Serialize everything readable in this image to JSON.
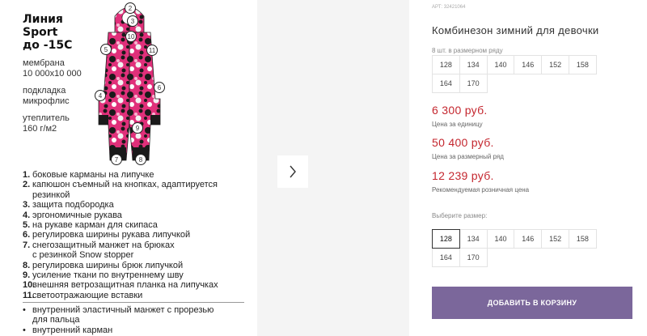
{
  "left_panel": {
    "line_title": [
      "Линия",
      "Sport",
      "до -15С"
    ],
    "specs": [
      "мембрана",
      "10 000х10 000",
      "подкладка",
      "микрофлис",
      "утеплитель",
      "160 г/м2"
    ],
    "numbered_features": [
      {
        "n": "1.",
        "text": "боковые карманы на липучке"
      },
      {
        "n": "2.",
        "text": "капюшон съемный на кнопках, адаптируется"
      },
      {
        "n": "",
        "text": "резинкой"
      },
      {
        "n": "3.",
        "text": "защита подбородка"
      },
      {
        "n": "4.",
        "text": "эргономичные рукава"
      },
      {
        "n": "5.",
        "text": "на рукаве карман для скипаса"
      },
      {
        "n": "6.",
        "text": "регулировка ширины рукава липучкой"
      },
      {
        "n": "7.",
        "text": "снегозащитный манжет на брюках"
      },
      {
        "n": "",
        "text": "с резинкой Snow stopper"
      },
      {
        "n": "8.",
        "text": "регулировка ширины брюк липучкой"
      },
      {
        "n": "9.",
        "text": "усиление ткани по внутреннему шву"
      },
      {
        "n": "10.",
        "text": "внешняя ветрозащитная планка на липучках"
      },
      {
        "n": "11.",
        "text": "светоотражающие вставки"
      }
    ],
    "bullet_features": [
      {
        "b": "•",
        "text": "внутренний эластичный манжет с прорезью"
      },
      {
        "b": "",
        "text": "для пальца"
      },
      {
        "b": "•",
        "text": "внутренний карман"
      }
    ],
    "callout_numbers": [
      "1",
      "2",
      "3",
      "4",
      "5",
      "6",
      "7",
      "8",
      "9",
      "10",
      "11"
    ],
    "suit_colors": {
      "pink": "#e0307a",
      "black": "#1a1a1a",
      "white": "#f2f2f2"
    }
  },
  "gallery": {
    "background": "#f4f4f4",
    "next_icon": "chevron-right-icon"
  },
  "product": {
    "article": "АРТ: 32421064",
    "title": "Комбинезон зимний для девочки",
    "sizes_in_row_label": "8 шт. в размерном ряду",
    "sizes_in_row": [
      "128",
      "134",
      "140",
      "146",
      "152",
      "158",
      "164",
      "170"
    ],
    "price_unit": "6 300 руб.",
    "price_unit_note": "Цена за единицу",
    "price_row": "50 400 руб.",
    "price_row_note": "Цена за размерный ряд",
    "price_retail": "12 239 руб.",
    "price_retail_note": "Рекомендуемая розничная цена",
    "choose_size_label": "Выберите размер:",
    "choose_sizes": [
      "128",
      "134",
      "140",
      "146",
      "152",
      "158",
      "164",
      "170"
    ],
    "selected_size": "128",
    "add_to_cart_label": "ДОБАВИТЬ В КОРЗИНУ",
    "accent_color": "#7b679b",
    "price_color": "#c4262e"
  }
}
